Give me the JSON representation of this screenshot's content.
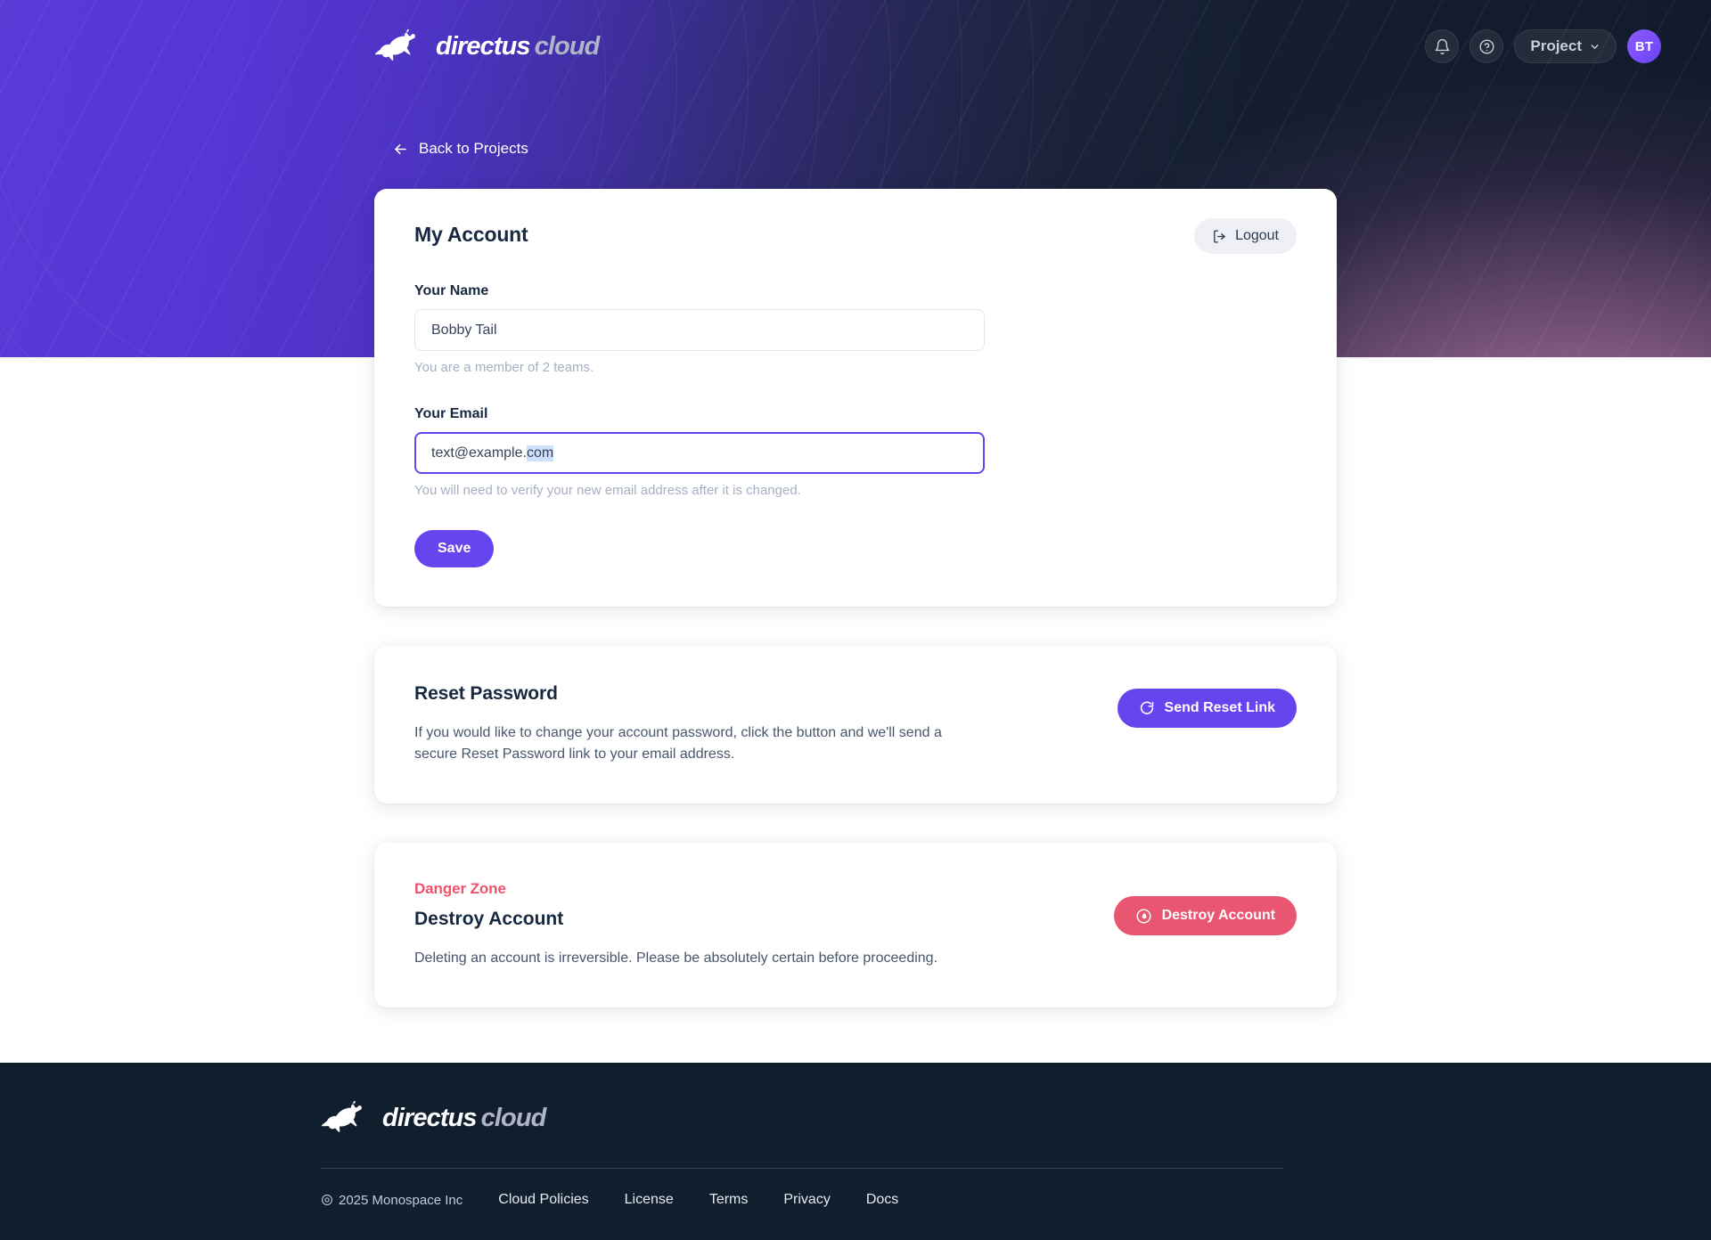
{
  "brand": {
    "word_primary": "directus",
    "word_secondary": "cloud",
    "logo_icon": "rabbit-logo-icon"
  },
  "topbar": {
    "notifications_icon": "bell-icon",
    "help_icon": "question-circle-icon",
    "project_label": "Project",
    "project_chevron_icon": "chevron-down-icon",
    "avatar_initials": "BT"
  },
  "back_link": {
    "label": "Back to Projects",
    "icon": "arrow-left-icon"
  },
  "account_card": {
    "title": "My Account",
    "logout_label": "Logout",
    "logout_icon": "logout-icon",
    "name_label": "Your Name",
    "name_value": "Bobby Tail",
    "name_hint": "You are a member of 2 teams.",
    "email_label": "Your Email",
    "email_value_plain": "text@example.",
    "email_value_selected": "com",
    "email_hint": "You will need to verify your new email address after it is changed.",
    "save_label": "Save"
  },
  "reset_card": {
    "title": "Reset Password",
    "body": "If you would like to change your account password, click the button and we'll send a secure Reset Password link to your email address.",
    "button_label": "Send Reset Link",
    "button_icon": "refresh-icon"
  },
  "danger_card": {
    "zone_label": "Danger Zone",
    "title": "Destroy Account",
    "body": "Deleting an account is irreversible. Please be absolutely certain before proceeding.",
    "button_label": "Destroy Account",
    "button_icon": "flame-icon"
  },
  "footer": {
    "copyright": "2025 Monospace Inc",
    "copyright_icon": "copyright-icon",
    "links": [
      {
        "label": "Cloud Policies"
      },
      {
        "label": "License"
      },
      {
        "label": "Terms"
      },
      {
        "label": "Privacy"
      },
      {
        "label": "Docs"
      }
    ]
  },
  "colors": {
    "accent_purple": "#6644EE",
    "danger_red": "#E85672",
    "danger_text": "#F0526C",
    "ink": "#172940",
    "hint": "#A6B0C2",
    "footer_bg": "#111E2E"
  }
}
